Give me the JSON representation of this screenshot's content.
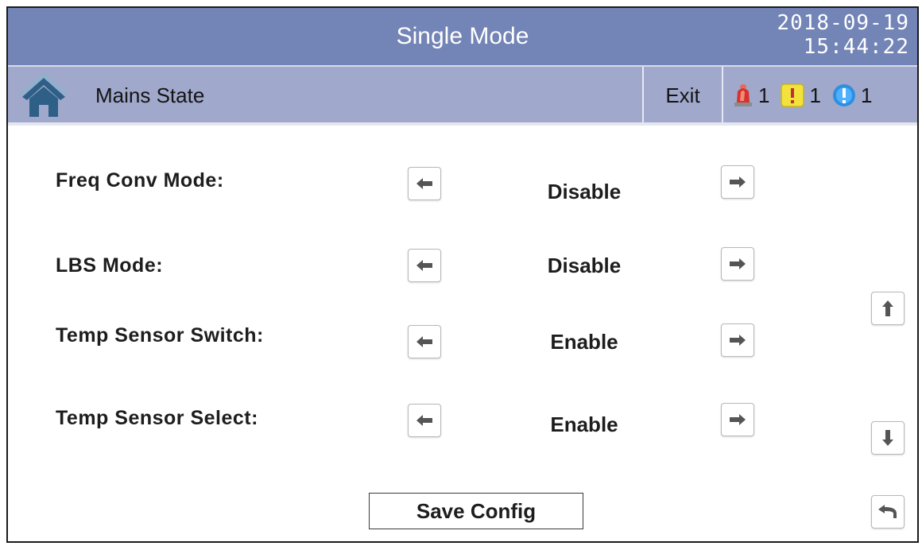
{
  "header": {
    "title": "Single Mode",
    "date": "2018-09-19",
    "time": "15:44:22"
  },
  "subheader": {
    "home_icon": "home-icon",
    "page_name": "Mains State",
    "exit_label": "Exit",
    "alarms": [
      {
        "icon": "siren-alarm-icon",
        "count": "1",
        "color": "#d9322b"
      },
      {
        "icon": "warning-exclamation-icon",
        "count": "1",
        "color": "#f3e23c"
      },
      {
        "icon": "info-exclamation-icon",
        "count": "1",
        "color": "#2e8fe0"
      }
    ]
  },
  "settings": [
    {
      "label": "Freq Conv Mode:",
      "value": "Disable"
    },
    {
      "label": "LBS Mode:",
      "value": "Disable"
    },
    {
      "label": "Temp Sensor Switch:",
      "value": "Enable"
    },
    {
      "label": "Temp Sensor Select:",
      "value": "Enable"
    }
  ],
  "footer": {
    "save_label": "Save Config"
  },
  "colors": {
    "titlebar": "#7384b6",
    "subbar": "#a0a8cb",
    "home_icon": "#2e5f87"
  }
}
